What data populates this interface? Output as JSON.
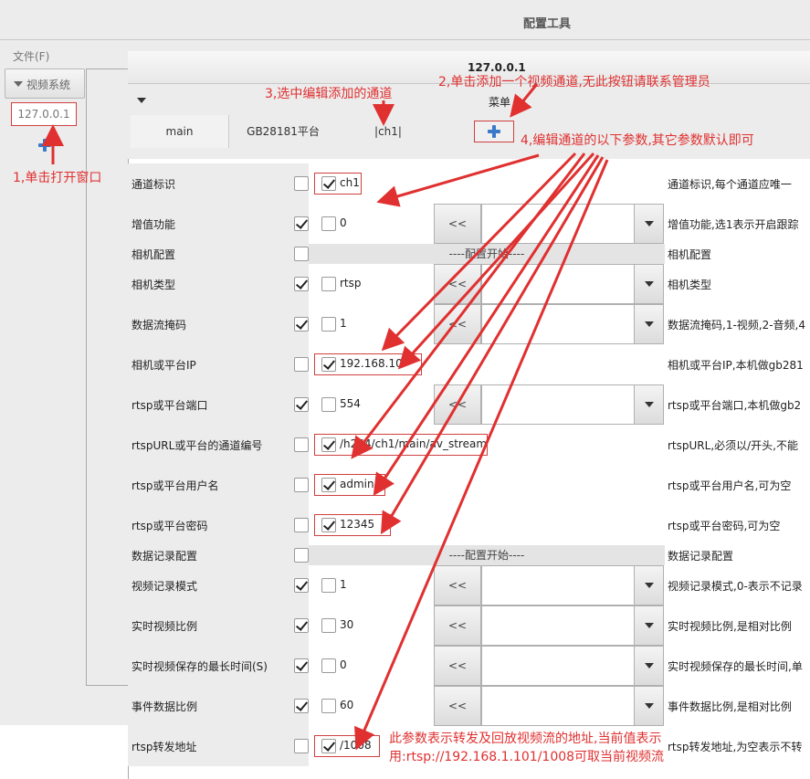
{
  "outer_window": {
    "title": "配置工具",
    "menu_file": "文件(F)",
    "video_system_button": "视频系统",
    "node_ip": "127.0.0.1"
  },
  "inner_window": {
    "title": "127.0.0.1",
    "menu_label": "菜单",
    "tabs": [
      "main",
      "GB28181平台",
      "|ch1|"
    ]
  },
  "rows": [
    {
      "label": "通道标识",
      "left_checked": false,
      "value_checked": true,
      "value": "ch1",
      "has_combo": false,
      "desc": "通道标识,每个通道应唯一"
    },
    {
      "label": "增值功能",
      "left_checked": true,
      "value_checked": false,
      "value": "0",
      "has_combo": true,
      "desc": "增值功能,选1表示开启跟踪"
    },
    {
      "label": "相机配置",
      "left_checked": false,
      "section": "----配置开始----",
      "desc": "相机配置"
    },
    {
      "label": "相机类型",
      "left_checked": true,
      "value_checked": false,
      "value": "rtsp",
      "has_combo": true,
      "desc": "相机类型"
    },
    {
      "label": "数据流掩码",
      "left_checked": true,
      "value_checked": false,
      "value": "1",
      "has_combo": true,
      "desc": "数据流掩码,1-视频,2-音频,4"
    },
    {
      "label": "相机或平台IP",
      "left_checked": false,
      "value_checked": true,
      "value": "192.168.10",
      "has_combo": false,
      "desc": "相机或平台IP,本机做gb281"
    },
    {
      "label": "rtsp或平台端口",
      "left_checked": true,
      "value_checked": false,
      "value": "554",
      "has_combo": true,
      "desc": "rtsp或平台端口,本机做gb2"
    },
    {
      "label": "rtspURL或平台的通道编号",
      "left_checked": false,
      "value_checked": true,
      "value": "/h264/ch1/main/av_stream",
      "has_combo": false,
      "desc": "rtspURL,必须以/开头,不能"
    },
    {
      "label": "rtsp或平台用户名",
      "left_checked": false,
      "value_checked": true,
      "value": "admin",
      "has_combo": false,
      "desc": "rtsp或平台用户名,可为空"
    },
    {
      "label": "rtsp或平台密码",
      "left_checked": false,
      "value_checked": true,
      "value": "12345",
      "has_combo": false,
      "desc": "rtsp或平台密码,可为空"
    },
    {
      "label": "数据记录配置",
      "left_checked": false,
      "section": "----配置开始----",
      "desc": "数据记录配置"
    },
    {
      "label": "视频记录模式",
      "left_checked": true,
      "value_checked": false,
      "value": "1",
      "has_combo": true,
      "desc": "视频记录模式,0-表示不记录"
    },
    {
      "label": "实时视频比例",
      "left_checked": true,
      "value_checked": false,
      "value": "30",
      "has_combo": true,
      "desc": "实时视频比例,是相对比例"
    },
    {
      "label": "实时视频保存的最长时间(S)",
      "left_checked": true,
      "value_checked": false,
      "value": "0",
      "has_combo": true,
      "desc": "实时视频保存的最长时间,单"
    },
    {
      "label": "事件数据比例",
      "left_checked": true,
      "value_checked": false,
      "value": "60",
      "has_combo": true,
      "desc": "事件数据比例,是相对比例"
    },
    {
      "label": "rtsp转发地址",
      "left_checked": false,
      "value_checked": true,
      "value": "/1008",
      "has_combo": false,
      "desc": "rtsp转发地址,为空表示不转"
    }
  ],
  "button_ll": "<<",
  "annotations": {
    "a1": "1,单击打开窗口",
    "a2": "2,单击添加一个视频通道,无此按钮请联系管理员",
    "a3": "3,选中编辑添加的通道",
    "a4": "4,编辑通道的以下参数,其它参数默认即可",
    "a5_line1": "此参数表示转发及回放视频流的地址,当前值表示",
    "a5_line2": "用:rtsp://192.168.1.101/1008可取当前视频流"
  },
  "colors": {
    "annotation_red": "#e03030",
    "plus_blue": "#3a78c8"
  }
}
